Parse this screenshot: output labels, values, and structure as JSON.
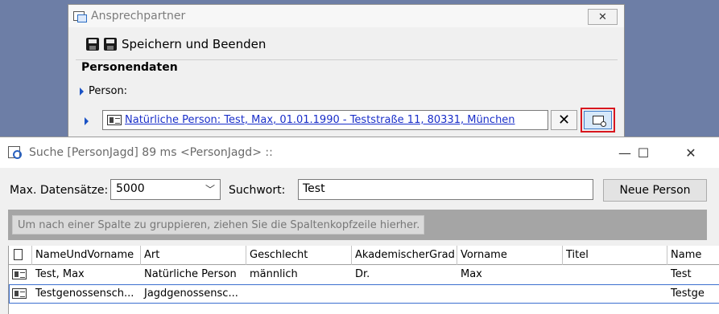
{
  "background_window": {
    "title": "Ansprechpartner",
    "close_label": "✕",
    "toolbar": {
      "save_close_label": "Speichern und Beenden"
    },
    "group_title": "Personendaten",
    "person_label": "Person:",
    "person_link": "Natürliche Person: Test, Max, 01.01.1990 - Teststraße 11, 80331, München",
    "clear_label": "✕"
  },
  "search_window": {
    "title": "Suche [PersonJagd] 89 ms <PersonJagd> ::",
    "controls": {
      "minimize": "—",
      "maximize": "☐",
      "close": "✕"
    },
    "max_records_label": "Max. Datensätze:",
    "max_records_value": "5000",
    "search_label": "Suchwort:",
    "search_value": "Test",
    "new_person_label": "Neue Person",
    "group_hint": "Um nach einer Spalte zu gruppieren, ziehen Sie die Spaltenkopfzeile hierher.",
    "columns": [
      "NameUndVorname",
      "Art",
      "Geschlecht",
      "AkademischerGrad",
      "Vorname",
      "Titel",
      "Name"
    ],
    "rows": [
      [
        "Test, Max",
        "Natürliche Person",
        "männlich",
        "Dr.",
        "Max",
        "",
        "Test"
      ],
      [
        "Testgenossensch...",
        "Jagdgenossensc...",
        "",
        "",
        "",
        "",
        "Testge"
      ]
    ]
  },
  "colors": {
    "desktop": "#6d7ea6",
    "link": "#1a2fc9",
    "highlight": "#d8161e",
    "selection": "#3b6fcf"
  }
}
